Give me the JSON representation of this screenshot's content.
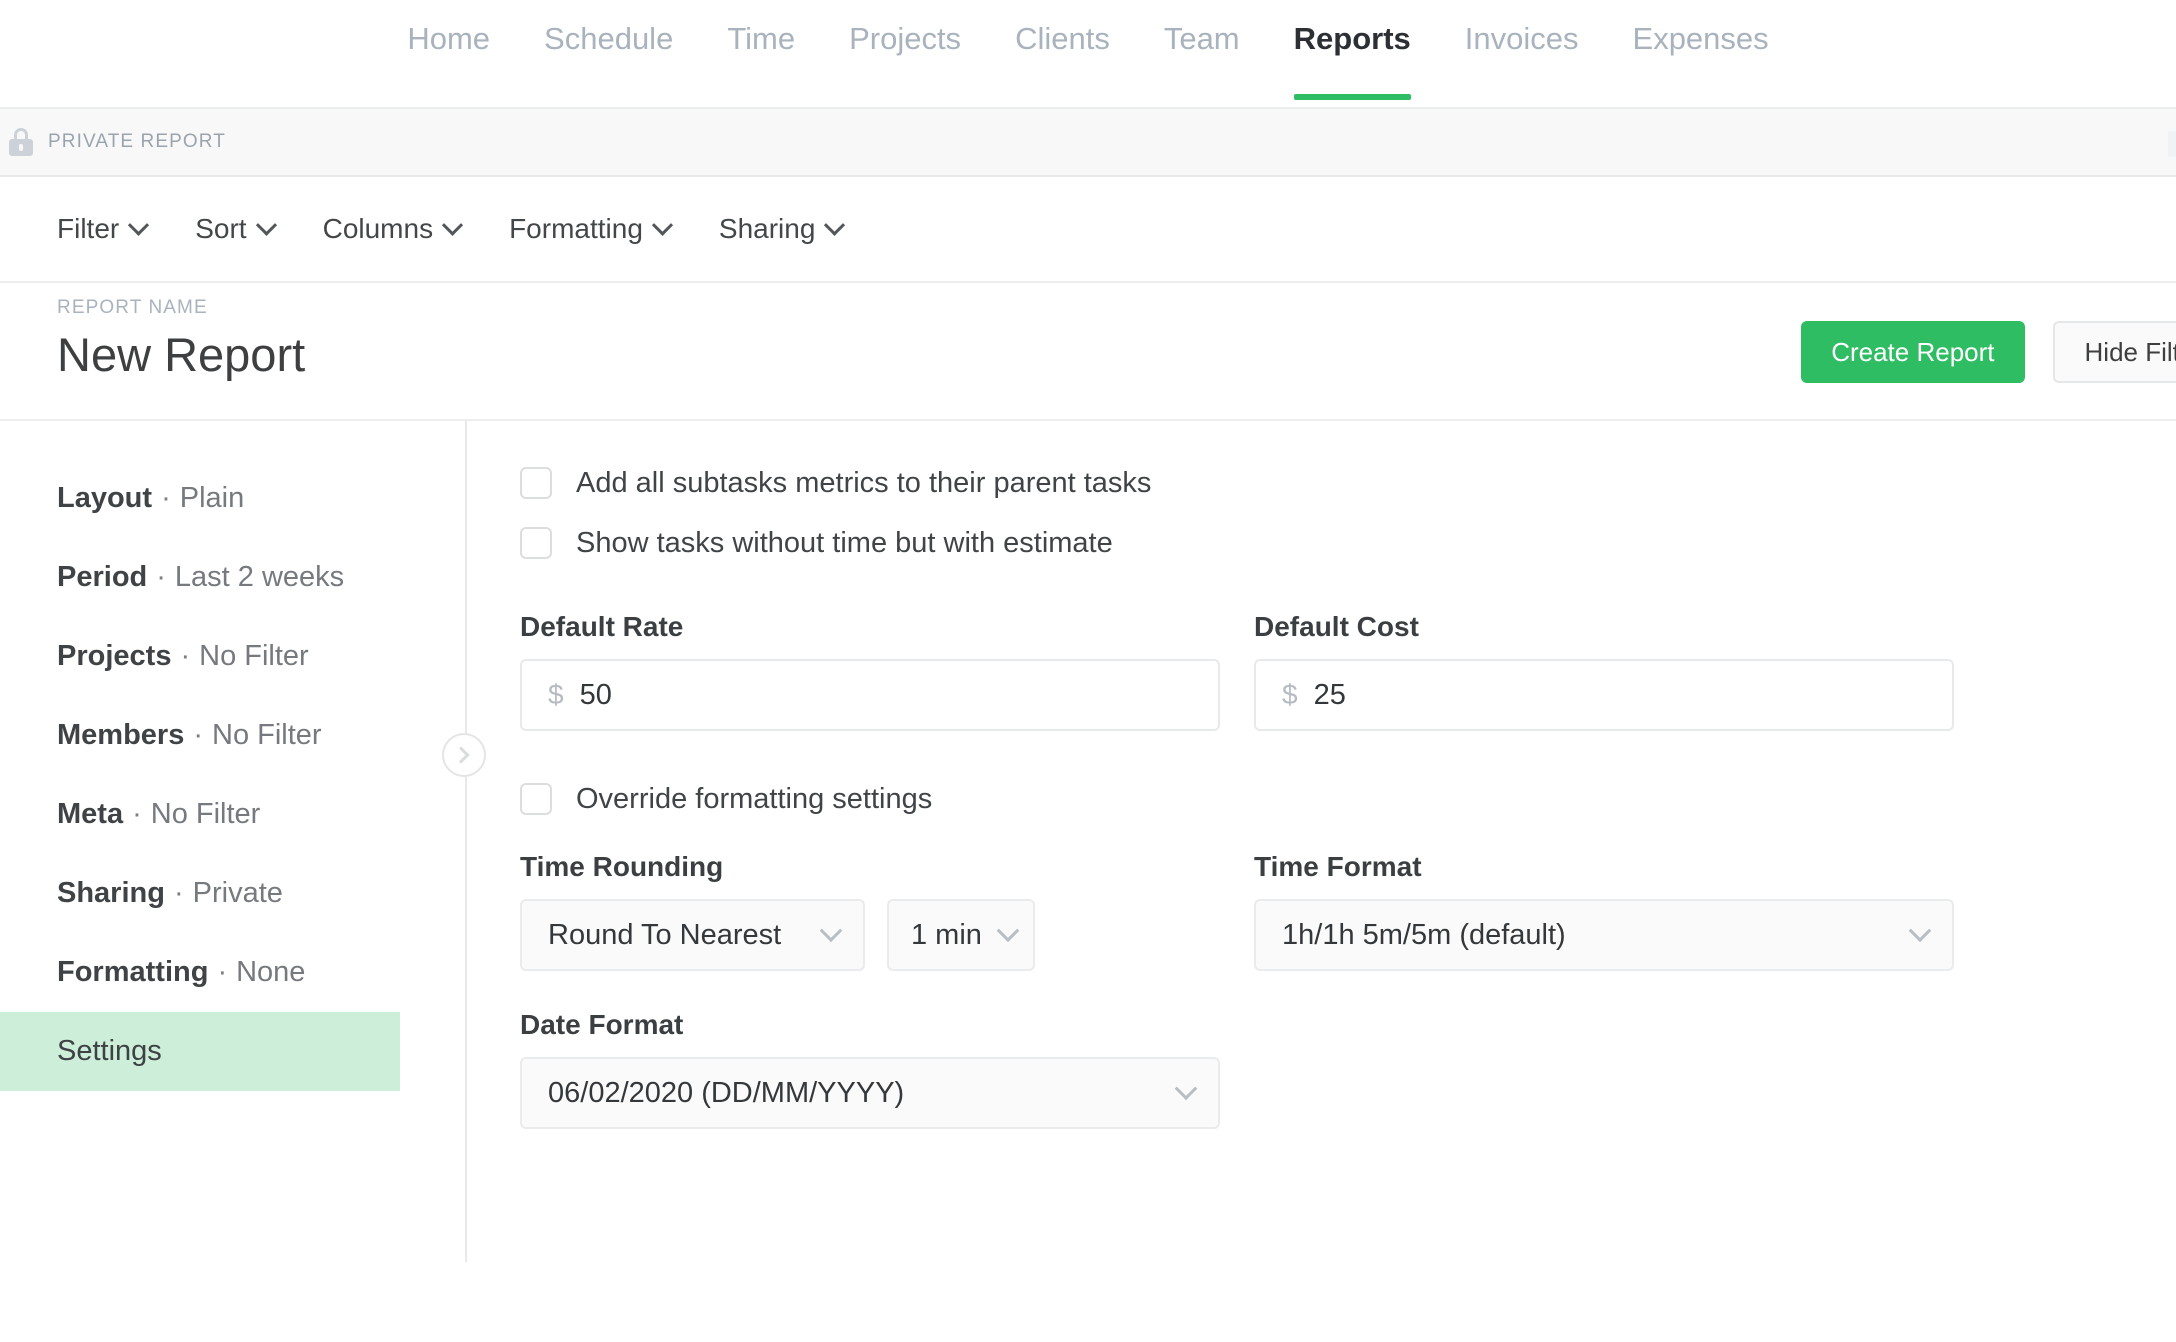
{
  "nav": {
    "items": [
      {
        "label": "Home",
        "active": false
      },
      {
        "label": "Schedule",
        "active": false
      },
      {
        "label": "Time",
        "active": false
      },
      {
        "label": "Projects",
        "active": false
      },
      {
        "label": "Clients",
        "active": false
      },
      {
        "label": "Team",
        "active": false
      },
      {
        "label": "Reports",
        "active": true
      },
      {
        "label": "Invoices",
        "active": false
      },
      {
        "label": "Expenses",
        "active": false
      }
    ]
  },
  "private_bar": {
    "label": "PRIVATE REPORT",
    "icon": "lock-icon"
  },
  "toolbar": {
    "items": [
      {
        "label": "Filter",
        "icon": "chevron-down-icon"
      },
      {
        "label": "Sort",
        "icon": "chevron-down-icon"
      },
      {
        "label": "Columns",
        "icon": "chevron-down-icon"
      },
      {
        "label": "Formatting",
        "icon": "chevron-down-icon"
      },
      {
        "label": "Sharing",
        "icon": "chevron-down-icon"
      }
    ]
  },
  "report_header": {
    "name_label": "REPORT NAME",
    "title": "New Report",
    "create_button": "Create Report",
    "hide_filters_button": "Hide Filters"
  },
  "sidebar": {
    "items": [
      {
        "label": "Layout",
        "value": "Plain",
        "selected": false
      },
      {
        "label": "Period",
        "value": "Last 2 weeks",
        "selected": false
      },
      {
        "label": "Projects",
        "value": "No Filter",
        "selected": false
      },
      {
        "label": "Members",
        "value": "No Filter",
        "selected": false
      },
      {
        "label": "Meta",
        "value": "No Filter",
        "selected": false
      },
      {
        "label": "Sharing",
        "value": "Private",
        "selected": false
      },
      {
        "label": "Formatting",
        "value": "None",
        "selected": false
      },
      {
        "label": "Settings",
        "value": "",
        "selected": true
      }
    ],
    "separator": "·",
    "collapse_icon": "chevron-right-icon"
  },
  "settings": {
    "checkbox_subtasks": {
      "label": "Add all subtasks metrics to their parent tasks",
      "checked": false
    },
    "checkbox_estimate": {
      "label": "Show tasks without time but with estimate",
      "checked": false
    },
    "default_rate": {
      "label": "Default Rate",
      "currency": "$",
      "value": "50"
    },
    "default_cost": {
      "label": "Default Cost",
      "currency": "$",
      "value": "25"
    },
    "checkbox_override": {
      "label": "Override formatting settings",
      "checked": false
    },
    "time_rounding": {
      "label": "Time Rounding",
      "mode_value": "Round To Nearest",
      "unit_value": "1 min",
      "icon": "chevron-down-icon"
    },
    "time_format": {
      "label": "Time Format",
      "value": "1h/1h 5m/5m (default)",
      "icon": "chevron-down-icon"
    },
    "date_format": {
      "label": "Date Format",
      "value": "06/02/2020 (DD/MM/YYYY)",
      "icon": "chevron-down-icon"
    }
  },
  "colors": {
    "accent_green": "#2ebd62",
    "selected_green": "#cdeed8",
    "muted_text": "#a9b3bd",
    "body_text": "#3d3f41"
  }
}
